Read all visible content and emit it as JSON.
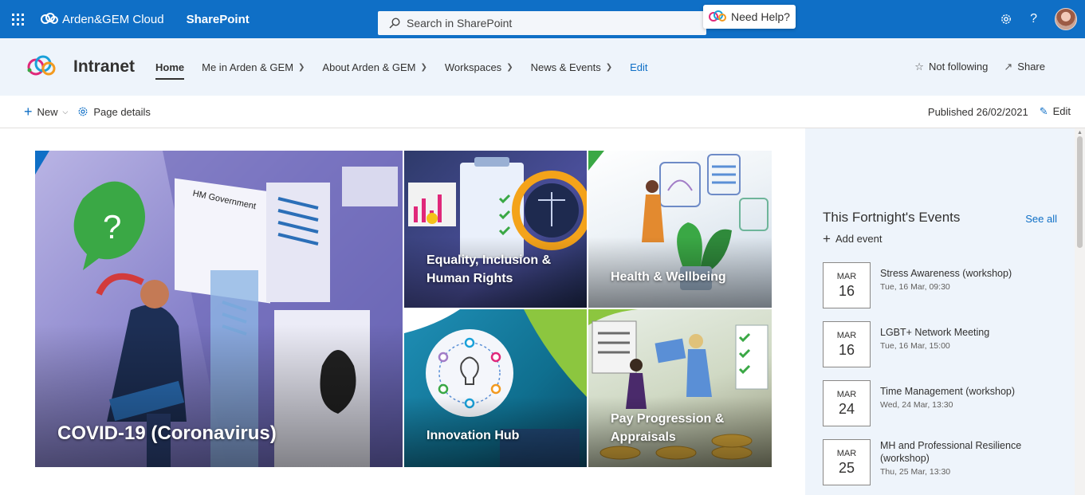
{
  "suitebar": {
    "org_name": "Arden&GEM Cloud",
    "app_name": "SharePoint",
    "search_placeholder": "Search in SharePoint",
    "need_help": "Need Help?",
    "help_glyph": "?"
  },
  "site": {
    "title": "Intranet",
    "nav": [
      {
        "label": "Home",
        "active": true
      },
      {
        "label": "Me in Arden & GEM"
      },
      {
        "label": "About Arden & GEM"
      },
      {
        "label": "Workspaces"
      },
      {
        "label": "News & Events"
      },
      {
        "label": "Edit"
      }
    ],
    "follow": "Not following",
    "share": "Share"
  },
  "commandbar": {
    "new_label": "New",
    "page_details": "Page details",
    "published": "Published 26/02/2021",
    "edit": "Edit"
  },
  "hero": {
    "tiles": [
      {
        "label": "COVID-19 (Coronavirus)"
      },
      {
        "label": "Equality, Inclusion & Human Rights"
      },
      {
        "label": "Health & Wellbeing"
      },
      {
        "label": "Innovation Hub"
      },
      {
        "label": "Pay Progression & Appraisals"
      }
    ],
    "covid_sign": "HM Government"
  },
  "events": {
    "title": "This Fortnight's Events",
    "see_all": "See all",
    "add_event": "Add event",
    "items": [
      {
        "month": "MAR",
        "day": "16",
        "name": "Stress Awareness (workshop)",
        "time": "Tue, 16 Mar, 09:30"
      },
      {
        "month": "MAR",
        "day": "16",
        "name": "LGBT+ Network Meeting",
        "time": "Tue, 16 Mar, 15:00"
      },
      {
        "month": "MAR",
        "day": "24",
        "name": "Time Management (workshop)",
        "time": "Wed, 24 Mar, 13:30"
      },
      {
        "month": "MAR",
        "day": "25",
        "name": "MH and Professional Resilience (workshop)",
        "time": "Thu, 25 Mar, 13:30"
      }
    ]
  },
  "colors": {
    "suitebar": "#0f6fc6",
    "header_bg": "#eef4fb",
    "link": "#0f6fc6"
  }
}
